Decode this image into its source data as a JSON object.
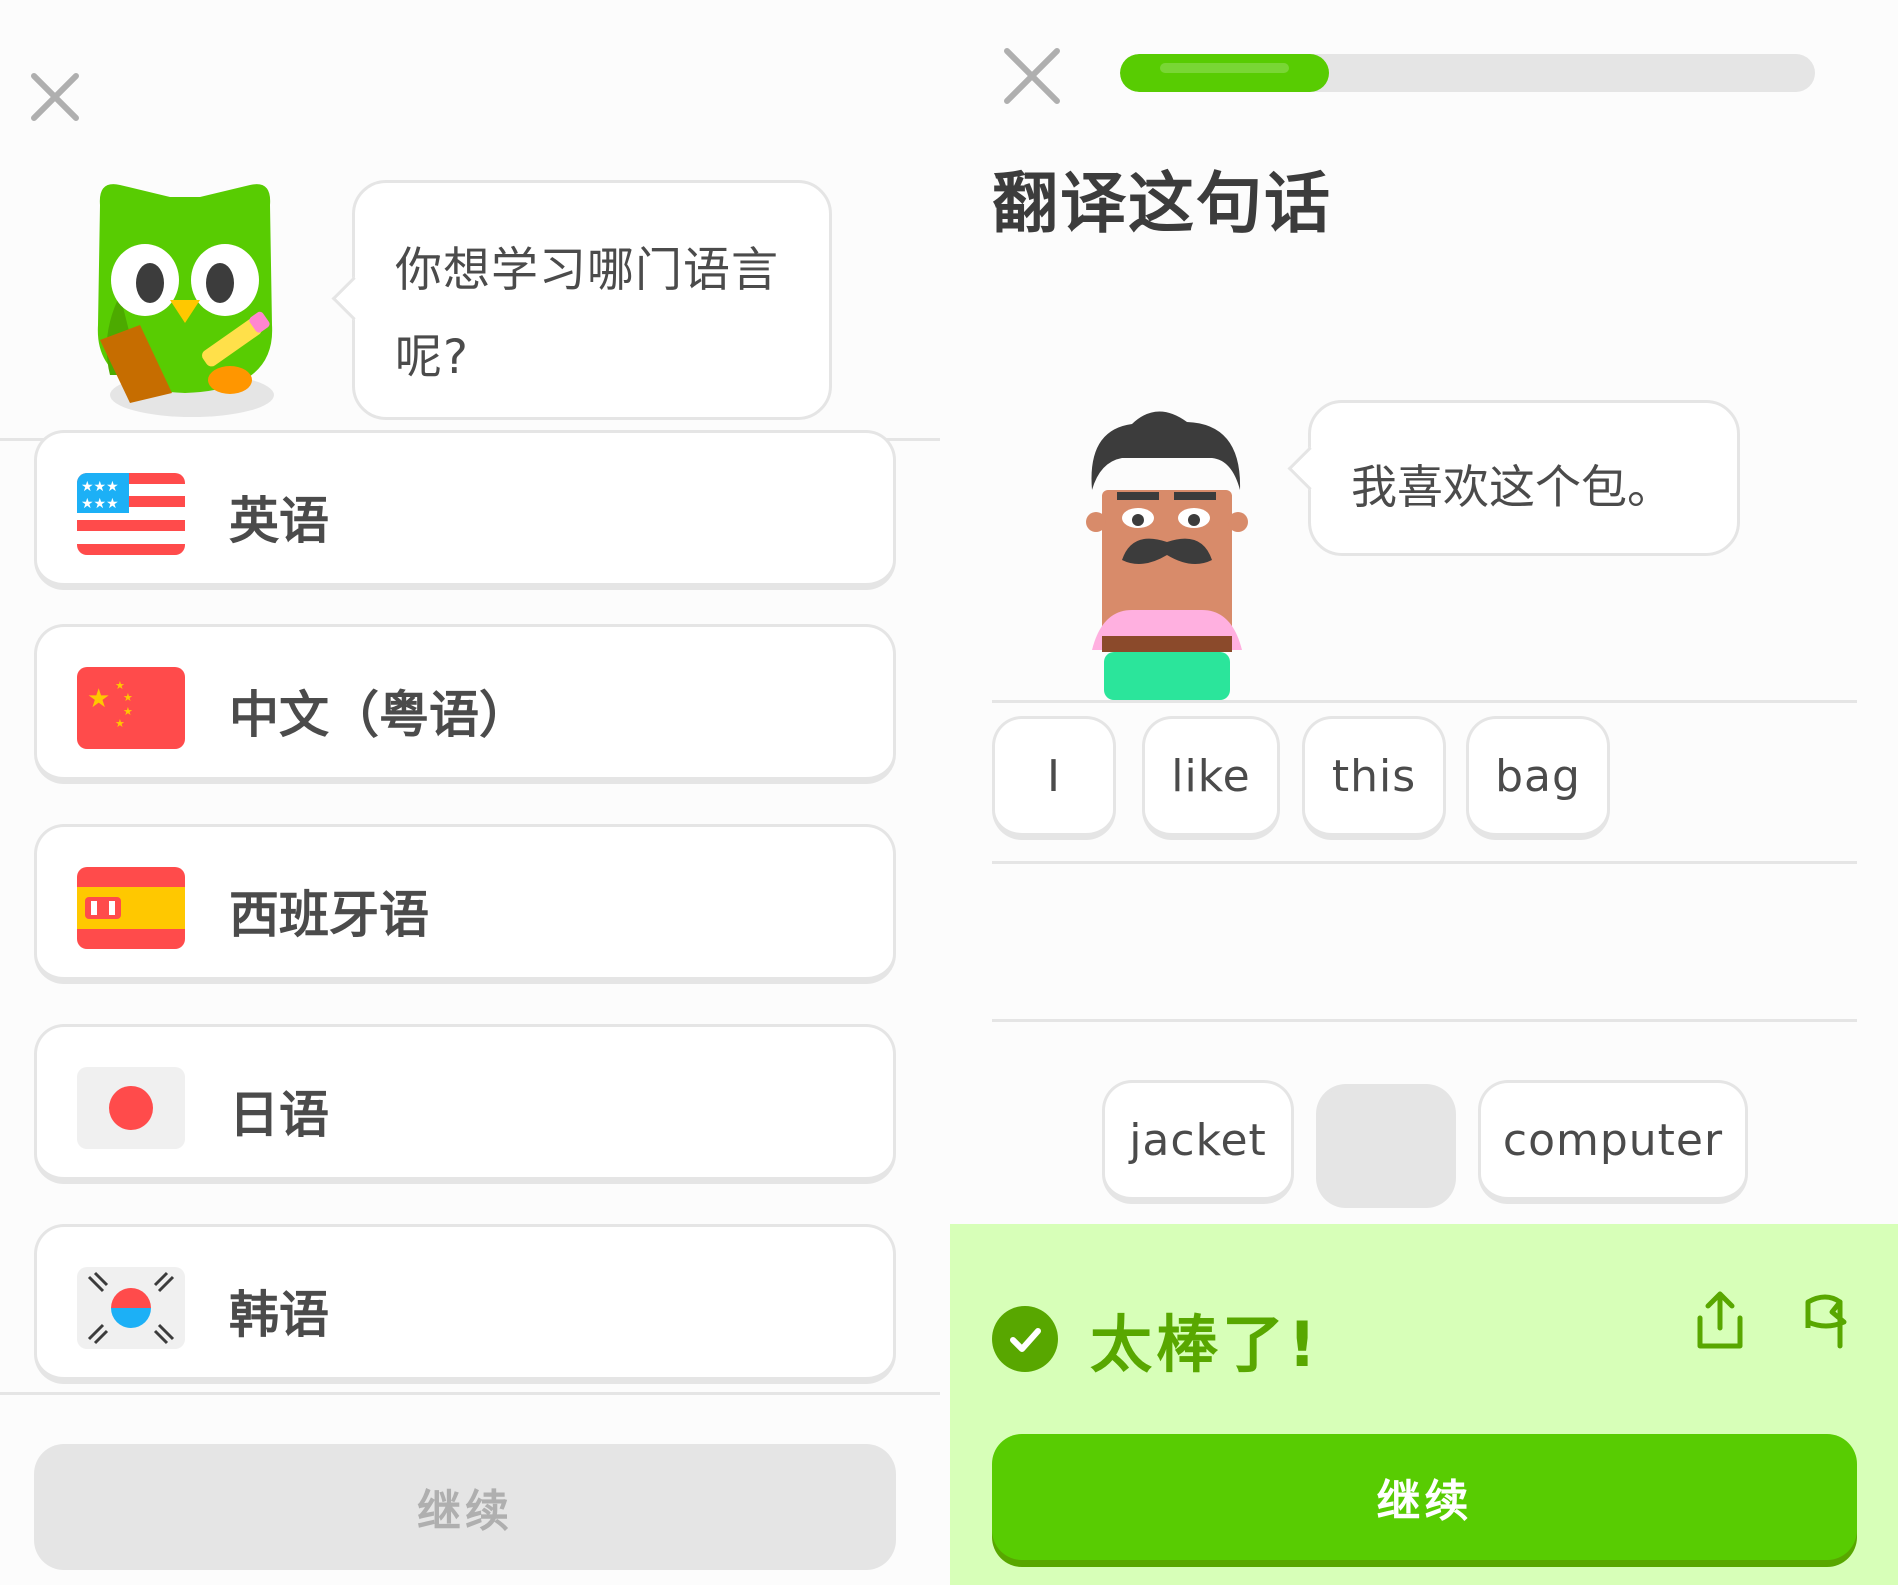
{
  "left_screen": {
    "prompt": "你想学习哪门语言呢?",
    "prompt_line1": "你想学习哪门语言",
    "prompt_line2": "呢?",
    "languages": [
      {
        "label": "英语",
        "flag": "us-flag-icon"
      },
      {
        "label": "中文（粤语）",
        "flag": "cn-flag-icon"
      },
      {
        "label": "西班牙语",
        "flag": "es-flag-icon"
      },
      {
        "label": "日语",
        "flag": "jp-flag-icon"
      },
      {
        "label": "韩语",
        "flag": "kr-flag-icon"
      }
    ],
    "continue_label": "继续"
  },
  "right_screen": {
    "progress": 0.3,
    "title": "翻译这句话",
    "sentence": "我喜欢这个包。",
    "answer_words": [
      "I",
      "like",
      "this",
      "bag"
    ],
    "bank_words": [
      "jacket",
      "",
      "computer"
    ],
    "feedback": "太棒了!",
    "continue_label": "继续"
  },
  "colors": {
    "brand_green": "#58cc02",
    "dark_green": "#58a700",
    "feedback_bg": "#d7ffb8",
    "border": "#e5e5e5",
    "disabled_text": "#afafaf"
  }
}
